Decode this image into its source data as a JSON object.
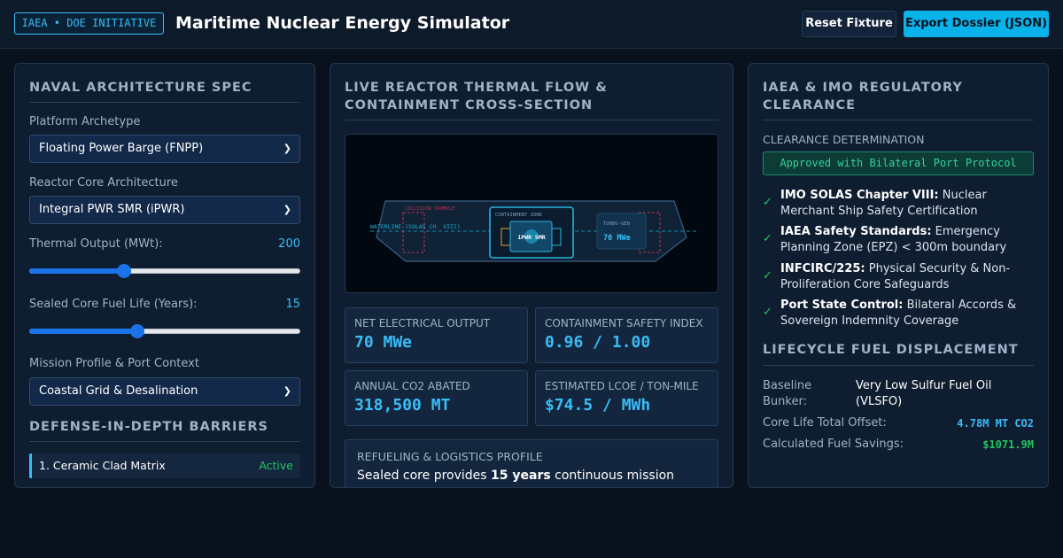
{
  "header": {
    "badge": "IAEA • DOE INITIATIVE",
    "title": "Maritime Nuclear Energy Simulator",
    "reset_label": "Reset Fixture",
    "export_label": "Export Dossier (JSON)"
  },
  "left": {
    "title": "NAVAL ARCHITECTURE SPEC",
    "platform_label": "Platform Archetype",
    "platform_value": "Floating Power Barge (FNPP)",
    "core_label": "Reactor Core Architecture",
    "core_value": "Integral PWR SMR (iPWR)",
    "thermal_label": "Thermal Output (MWt):",
    "thermal_value": "200",
    "thermal_fraction": 0.35,
    "fuel_label": "Sealed Core Fuel Life (Years):",
    "fuel_value": "15",
    "fuel_fraction": 0.4,
    "mission_label": "Mission Profile & Port Context",
    "mission_value": "Coastal Grid & Desalination",
    "barriers_title": "DEFENSE-IN-DEPTH BARRIERS",
    "barriers": [
      {
        "label": "1. Ceramic Clad Matrix",
        "status": "Active"
      }
    ]
  },
  "middle": {
    "title": "LIVE REACTOR THERMAL FLOW & CONTAINMENT CROSS-SECTION",
    "diagram": {
      "collision": "COLLISION CRUMPLE",
      "waterline": "WATERLINE (SOLAS CH. VIII)",
      "containment": "CONTAINMENT ZONE",
      "reactor": "iPWR SMR",
      "turbo": "TURBO-GEN",
      "turbo_value": "70 MWe"
    },
    "metrics": [
      {
        "label": "NET ELECTRICAL OUTPUT",
        "value": "70 MWe"
      },
      {
        "label": "CONTAINMENT SAFETY INDEX",
        "value": "0.96 / 1.00"
      },
      {
        "label": "ANNUAL CO2 ABATED",
        "value": "318,500 MT"
      },
      {
        "label": "ESTIMATED LCOE / TON-MILE",
        "value": "$74.5 / MWh"
      }
    ],
    "refuel_label": "REFUELING & LOGISTICS PROFILE",
    "refuel_pre": "Sealed core provides ",
    "refuel_bold": "15 years",
    "refuel_post": " continuous mission"
  },
  "right": {
    "title": "IAEA & IMO REGULATORY CLEARANCE",
    "clearance_label": "CLEARANCE DETERMINATION",
    "clearance_value": "Approved with Bilateral Port Protocol",
    "checks": [
      {
        "bold": "IMO SOLAS Chapter VIII:",
        "text": " Nuclear Merchant Ship Safety Certification"
      },
      {
        "bold": "IAEA Safety Standards:",
        "text": " Emergency Planning Zone (EPZ) < 300m boundary"
      },
      {
        "bold": "INFCIRC/225:",
        "text": " Physical Security & Non-Proliferation Core Safeguards"
      },
      {
        "bold": "Port State Control:",
        "text": " Bilateral Accords & Sovereign Indemnity Coverage"
      }
    ],
    "fuel_title": "LIFECYCLE FUEL DISPLACEMENT",
    "baseline_label": "Baseline Bunker:",
    "baseline_value": "Very Low Sulfur Fuel Oil (VLSFO)",
    "offset_label": "Core Life Total Offset:",
    "offset_value": "4.78M MT CO2",
    "savings_label": "Calculated Fuel Savings:",
    "savings_value": "$1071.9M"
  },
  "colors": {
    "accent": "#38bdf8",
    "success": "#22c55e",
    "background": "#08111c",
    "panel": "#0f1d30"
  }
}
